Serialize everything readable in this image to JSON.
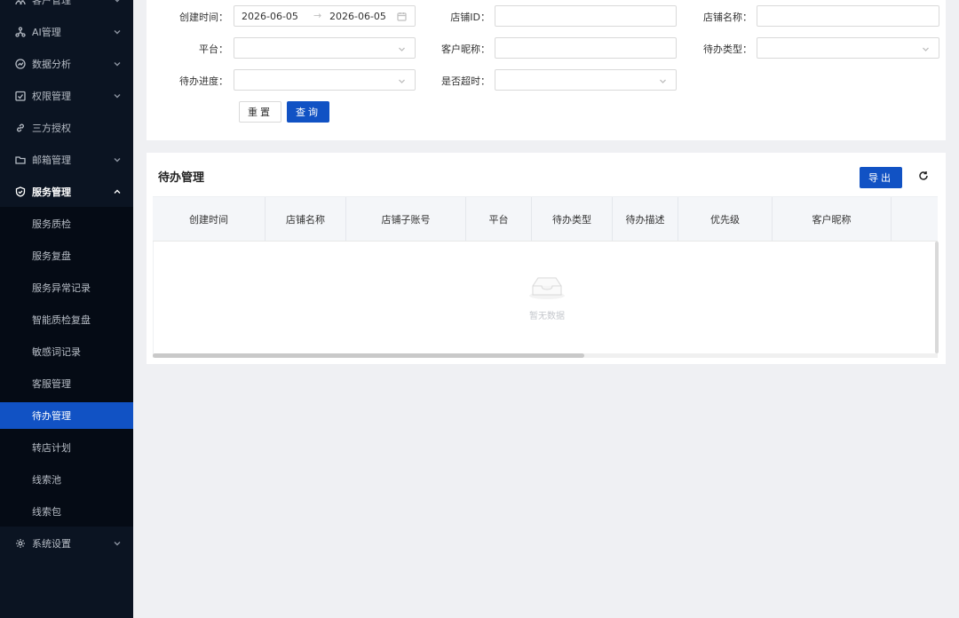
{
  "sidebar": {
    "items": [
      {
        "label": "客户管理",
        "icon": "users-icon"
      },
      {
        "label": "AI管理",
        "icon": "ai-icon"
      },
      {
        "label": "数据分析",
        "icon": "analytics-icon"
      },
      {
        "label": "权限管理",
        "icon": "permission-icon"
      },
      {
        "label": "三方授权",
        "icon": "link-icon"
      },
      {
        "label": "邮箱管理",
        "icon": "folder-icon"
      },
      {
        "label": "服务管理",
        "icon": "shield-icon"
      },
      {
        "label": "系统设置",
        "icon": "gear-icon"
      }
    ],
    "submenu": [
      {
        "label": "服务质检"
      },
      {
        "label": "服务复盘"
      },
      {
        "label": "服务异常记录"
      },
      {
        "label": "智能质检复盘"
      },
      {
        "label": "敏感词记录"
      },
      {
        "label": "客服管理"
      },
      {
        "label": "待办管理"
      },
      {
        "label": "转店计划"
      },
      {
        "label": "线索池"
      },
      {
        "label": "线索包"
      }
    ],
    "active_item": "待办管理",
    "colors": {
      "background": "#0b1422",
      "submenu_background": "#050b15",
      "active": "#1152c4"
    }
  },
  "search": {
    "fields": {
      "created_time": {
        "label": "创建时间：",
        "start": "2026-06-05",
        "separator": "→",
        "end": "2026-06-05"
      },
      "shop_id": {
        "label": "店铺ID：",
        "value": ""
      },
      "shop_name": {
        "label": "店铺名称：",
        "value": ""
      },
      "platform": {
        "label": "平台：",
        "value": ""
      },
      "customer_nickname": {
        "label": "客户昵称：",
        "value": ""
      },
      "todo_type": {
        "label": "待办类型：",
        "value": ""
      },
      "todo_progress": {
        "label": "待办进度：",
        "value": ""
      },
      "is_overdue": {
        "label": "是否超时：",
        "value": ""
      }
    },
    "reset_label": "重置",
    "query_label": "查询"
  },
  "table": {
    "title": "待办管理",
    "export_label": "导出",
    "columns": [
      "创建时间",
      "店铺名称",
      "店铺子账号",
      "平台",
      "待办类型",
      "待办描述",
      "优先级",
      "客户昵称"
    ],
    "rows": [],
    "empty_text": "暂无数据",
    "horizontal_scroll_fraction": 0.55
  },
  "theme": {
    "primary": "#1152c4",
    "page_background": "#eff0f3"
  }
}
